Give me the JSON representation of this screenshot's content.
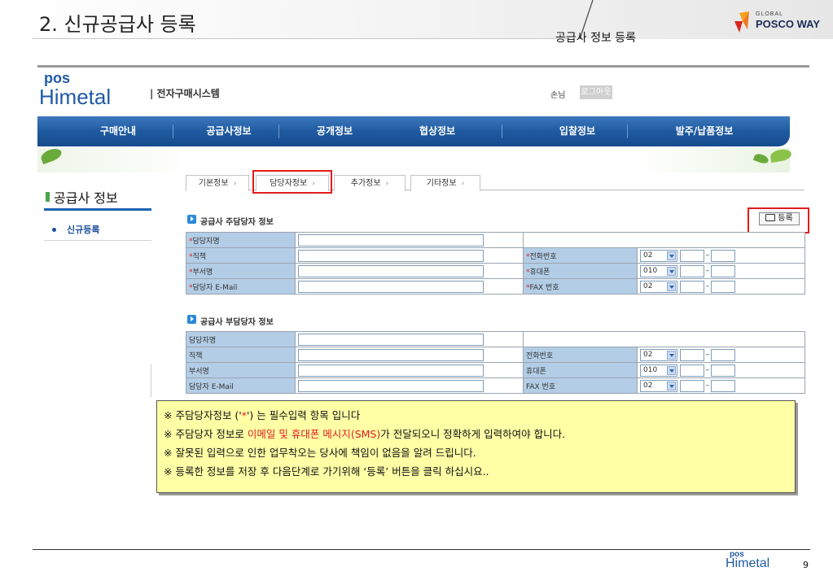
{
  "slide": {
    "title": "2. 신규공급사 등록",
    "section_label": "공급사 정보 등록",
    "brand_small": "GLOBAL",
    "brand_big": "POSCO WAY",
    "page_number": "9"
  },
  "app": {
    "logo_pos": "pos",
    "logo_name": "Himetal",
    "system_title": "| 전자구매시스템",
    "guest_label": "손님",
    "logout_label": "로그아웃"
  },
  "nav": {
    "items": [
      "구매안내",
      "공급사정보",
      "공개정보",
      "협상정보",
      "입찰정보",
      "발주/납품정보"
    ]
  },
  "sidebar": {
    "title": "공급사 정보",
    "items": [
      "신규등록"
    ]
  },
  "tabs": [
    "기본정보",
    "담당자정보",
    "추가정보",
    "기타정보"
  ],
  "tab_arrow": "›",
  "register_button": "등록",
  "primary": {
    "heading": "공급사 주담당자 정보",
    "req_mark": "*",
    "rows": [
      {
        "label": "담당자명"
      },
      {
        "label": "직책",
        "label2": "전화번호",
        "prefix": "02"
      },
      {
        "label": "부서명",
        "label2": "휴대폰",
        "prefix": "010"
      },
      {
        "label": "담당자 E-Mail",
        "label2": "FAX 번호",
        "prefix": "02"
      }
    ]
  },
  "secondary": {
    "heading": "공급사 부담당자 정보",
    "rows": [
      {
        "label": "담당자명"
      },
      {
        "label": "직책",
        "label2": "전화번호",
        "prefix": "02"
      },
      {
        "label": "부서명",
        "label2": "휴대폰",
        "prefix": "010"
      },
      {
        "label": "담당자 E-Mail",
        "label2": "FAX 번호",
        "prefix": "02"
      }
    ]
  },
  "notes": {
    "line1_a": "※ 주담당자정보 ('",
    "line1_star": "*",
    "line1_b": "') 는 필수입력 항목 입니다",
    "line2_a": "※ 주담당자 정보로 ",
    "line2_red": "이메일 및 휴대폰 메시지(SMS)",
    "line2_b": "가 전달되오니 정확하게 입력하여야 합니다.",
    "line3": "※ 잘못된 입력으로 인한 업무착오는 당사에 책임이 없음을 알려 드립니다.",
    "line4": "※ 등록한 정보를 저장 후 다음단계로 가기위해 ‘등록’ 버튼을 클릭 하십시요.."
  }
}
